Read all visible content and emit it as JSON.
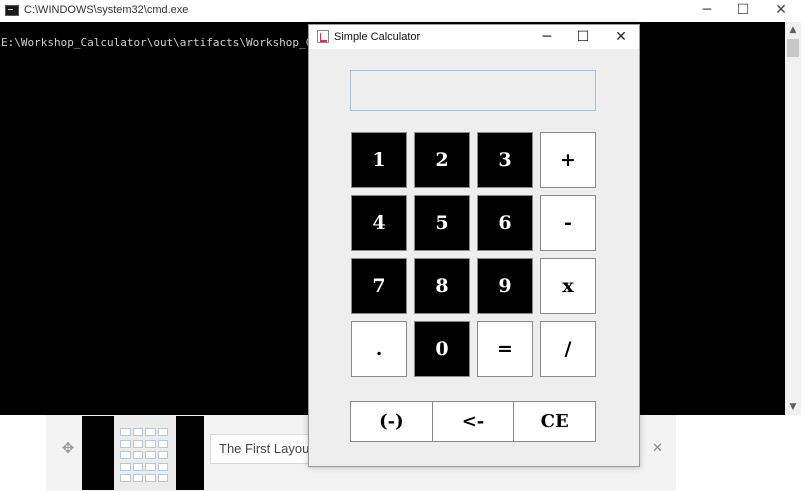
{
  "cmd": {
    "title": "C:\\WINDOWS\\system32\\cmd.exe",
    "line": "E:\\Workshop_Calculator\\out\\artifacts\\Workshop_C",
    "minimize": "─",
    "maximize": "☐",
    "close": "✕",
    "scroll_up": "▲",
    "scroll_down": "▼"
  },
  "layout_panel": {
    "move_icon": "✥",
    "input_value": "The First Layout",
    "close": "✕"
  },
  "calculator": {
    "title": "Simple Calculator",
    "minimize": "─",
    "maximize": "☐",
    "close": "✕",
    "display_value": "",
    "keys": {
      "k1": "1",
      "k2": "2",
      "k3": "3",
      "plus": "+",
      "k4": "4",
      "k5": "5",
      "k6": "6",
      "minus": "-",
      "k7": "7",
      "k8": "8",
      "k9": "9",
      "multiply": "x",
      "dot": ".",
      "k0": "0",
      "equals": "=",
      "divide": "/"
    },
    "bottom": {
      "negate": "(-)",
      "backspace": "<-",
      "clear": "CE"
    }
  }
}
